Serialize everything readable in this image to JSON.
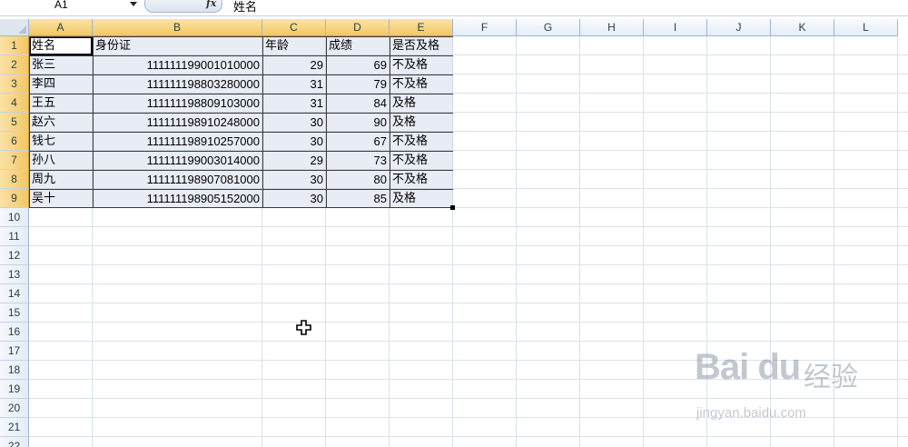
{
  "formula_bar": {
    "name_box": "A1",
    "fx_label": "fx",
    "content": "姓名"
  },
  "columns": [
    "A",
    "B",
    "C",
    "D",
    "E",
    "F",
    "G",
    "H",
    "I",
    "J",
    "K",
    "L"
  ],
  "selected_columns": [
    "A",
    "B",
    "C",
    "D",
    "E"
  ],
  "rows": [
    "1",
    "2",
    "3",
    "4",
    "5",
    "6",
    "7",
    "8",
    "9",
    "10",
    "11",
    "12",
    "13",
    "14",
    "15",
    "16",
    "17",
    "18",
    "19",
    "20",
    "21",
    "22"
  ],
  "selected_rows": [
    "1",
    "2",
    "3",
    "4",
    "5",
    "6",
    "7",
    "8",
    "9"
  ],
  "table": {
    "headers": [
      "姓名",
      "身份证",
      "年龄",
      "成绩",
      "是否及格"
    ],
    "rows": [
      [
        "张三",
        "111111199001010000",
        "29",
        "69",
        "不及格"
      ],
      [
        "李四",
        "111111198803280000",
        "31",
        "79",
        "不及格"
      ],
      [
        "王五",
        "111111198809103000",
        "31",
        "84",
        "及格"
      ],
      [
        "赵六",
        "111111198910248000",
        "30",
        "90",
        "及格"
      ],
      [
        "钱七",
        "111111198910257000",
        "30",
        "67",
        "不及格"
      ],
      [
        "孙八",
        "111111199003014000",
        "29",
        "73",
        "不及格"
      ],
      [
        "周九",
        "111111198907081000",
        "30",
        "80",
        "不及格"
      ],
      [
        "吴十",
        "111111198905152000",
        "30",
        "85",
        "及格"
      ]
    ]
  },
  "watermark": {
    "logo": "Bai du",
    "sub": "经验",
    "url": "jingyan.baidu.com"
  },
  "colors": {
    "selection": "#bec8e1",
    "header_selected": "#f3c765",
    "gridline": "#dae2ec"
  }
}
